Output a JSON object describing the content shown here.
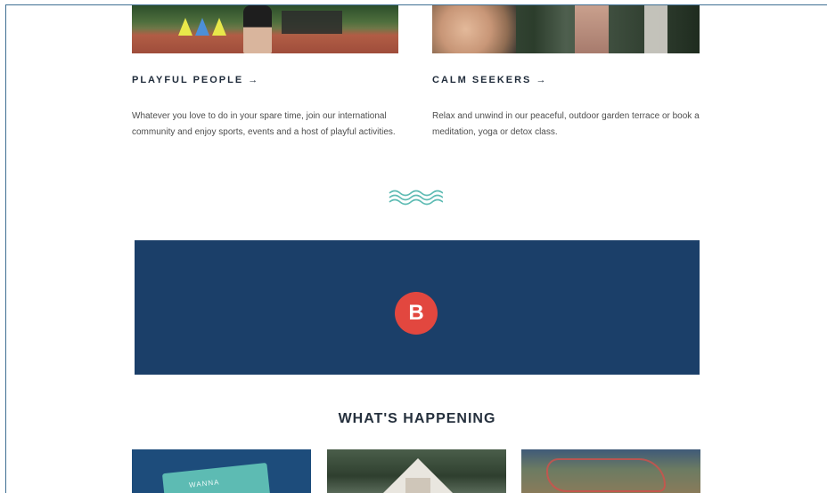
{
  "features": [
    {
      "title": "PLAYFUL PEOPLE →",
      "text": "Whatever you love to do in your spare time, join our international community and enjoy sports, events and a host of playful activities."
    },
    {
      "title": "CALM SEEKERS →",
      "text": "Relax and unwind in our peaceful, outdoor garden terrace or book a meditation, yoga or detox class."
    }
  ],
  "banner": {
    "badge": "B"
  },
  "section": {
    "title": "WHAT'S HAPPENING"
  },
  "cards": [
    {
      "tag": "WANNA"
    },
    {
      "tag": ""
    },
    {
      "tag": ""
    }
  ],
  "colors": {
    "banner": "#1b3f69",
    "badge": "#e2473f",
    "wave": "#5dbbb3",
    "heading": "#1f2b3a"
  },
  "icons": {
    "wave": "wave-icon"
  }
}
